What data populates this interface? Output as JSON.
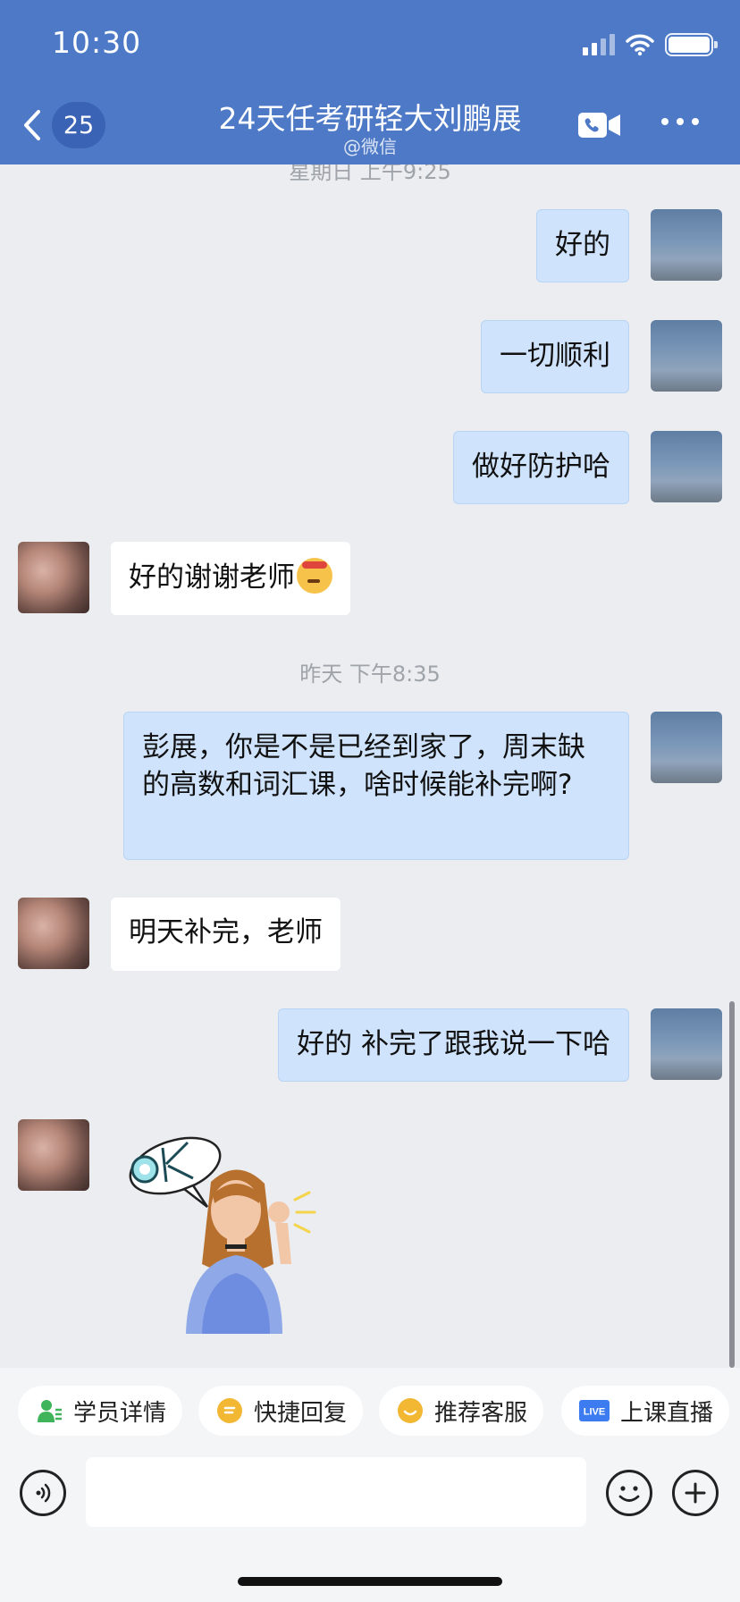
{
  "status": {
    "time": "10:30"
  },
  "header": {
    "unread_count": "25",
    "title": "24天任考研轻大刘鹏展",
    "subtitle": "@微信"
  },
  "chat": {
    "timestamp_top": "星期日 上午9:25",
    "timestamp_yesterday": "昨天 下午8:35",
    "messages": [
      {
        "from": "self",
        "text": "好的"
      },
      {
        "from": "self",
        "text": "一切顺利"
      },
      {
        "from": "self",
        "text": "做好防护哈"
      },
      {
        "from": "other",
        "text": "好的谢谢老师"
      },
      {
        "from": "self",
        "text": "彭展，你是不是已经到家了，周末缺的高数和词汇课，啥时候能补完啊?"
      },
      {
        "from": "other",
        "text": "明天补完，老师"
      },
      {
        "from": "self",
        "text": "好的 补完了跟我说一下哈"
      },
      {
        "from": "other",
        "sticker_text": "OK"
      }
    ]
  },
  "quick_actions": [
    {
      "label": "学员详情",
      "icon": "student-icon",
      "color": "#3fb45a"
    },
    {
      "label": "快捷回复",
      "icon": "quick-reply-icon",
      "color": "#f2b733"
    },
    {
      "label": "推荐客服",
      "icon": "service-icon",
      "color": "#f2b733"
    },
    {
      "label": "上课直播",
      "icon": "live-icon",
      "color": "#3d7cf0",
      "badge": "LIVE"
    }
  ],
  "colors": {
    "header": "#4d79c6",
    "self_bubble": "#cfe3fc",
    "background": "#ebedf0"
  }
}
